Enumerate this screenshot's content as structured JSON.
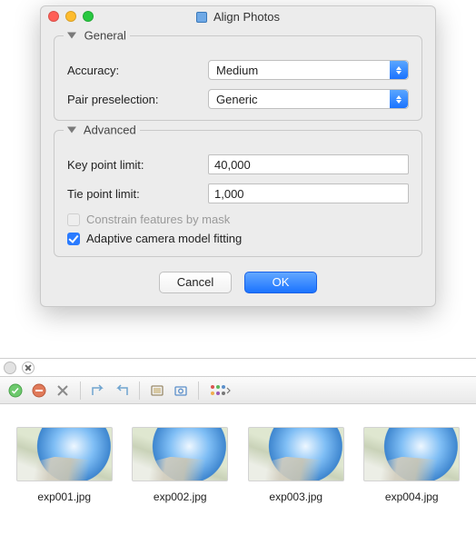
{
  "dialog": {
    "title": "Align Photos",
    "general": {
      "legend": "General",
      "accuracy_label": "Accuracy:",
      "accuracy_value": "Medium",
      "pair_label": "Pair preselection:",
      "pair_value": "Generic"
    },
    "advanced": {
      "legend": "Advanced",
      "keypoint_label": "Key point limit:",
      "keypoint_value": "40,000",
      "tiepoint_label": "Tie point limit:",
      "tiepoint_value": "1,000",
      "constrain_label": "Constrain features by mask",
      "constrain_checked": false,
      "constrain_enabled": false,
      "adaptive_label": "Adaptive camera model fitting",
      "adaptive_checked": true
    },
    "buttons": {
      "cancel": "Cancel",
      "ok": "OK"
    }
  },
  "thumbnails": [
    {
      "caption": "exp001.jpg"
    },
    {
      "caption": "exp002.jpg"
    },
    {
      "caption": "exp003.jpg"
    },
    {
      "caption": "exp004.jpg"
    }
  ]
}
